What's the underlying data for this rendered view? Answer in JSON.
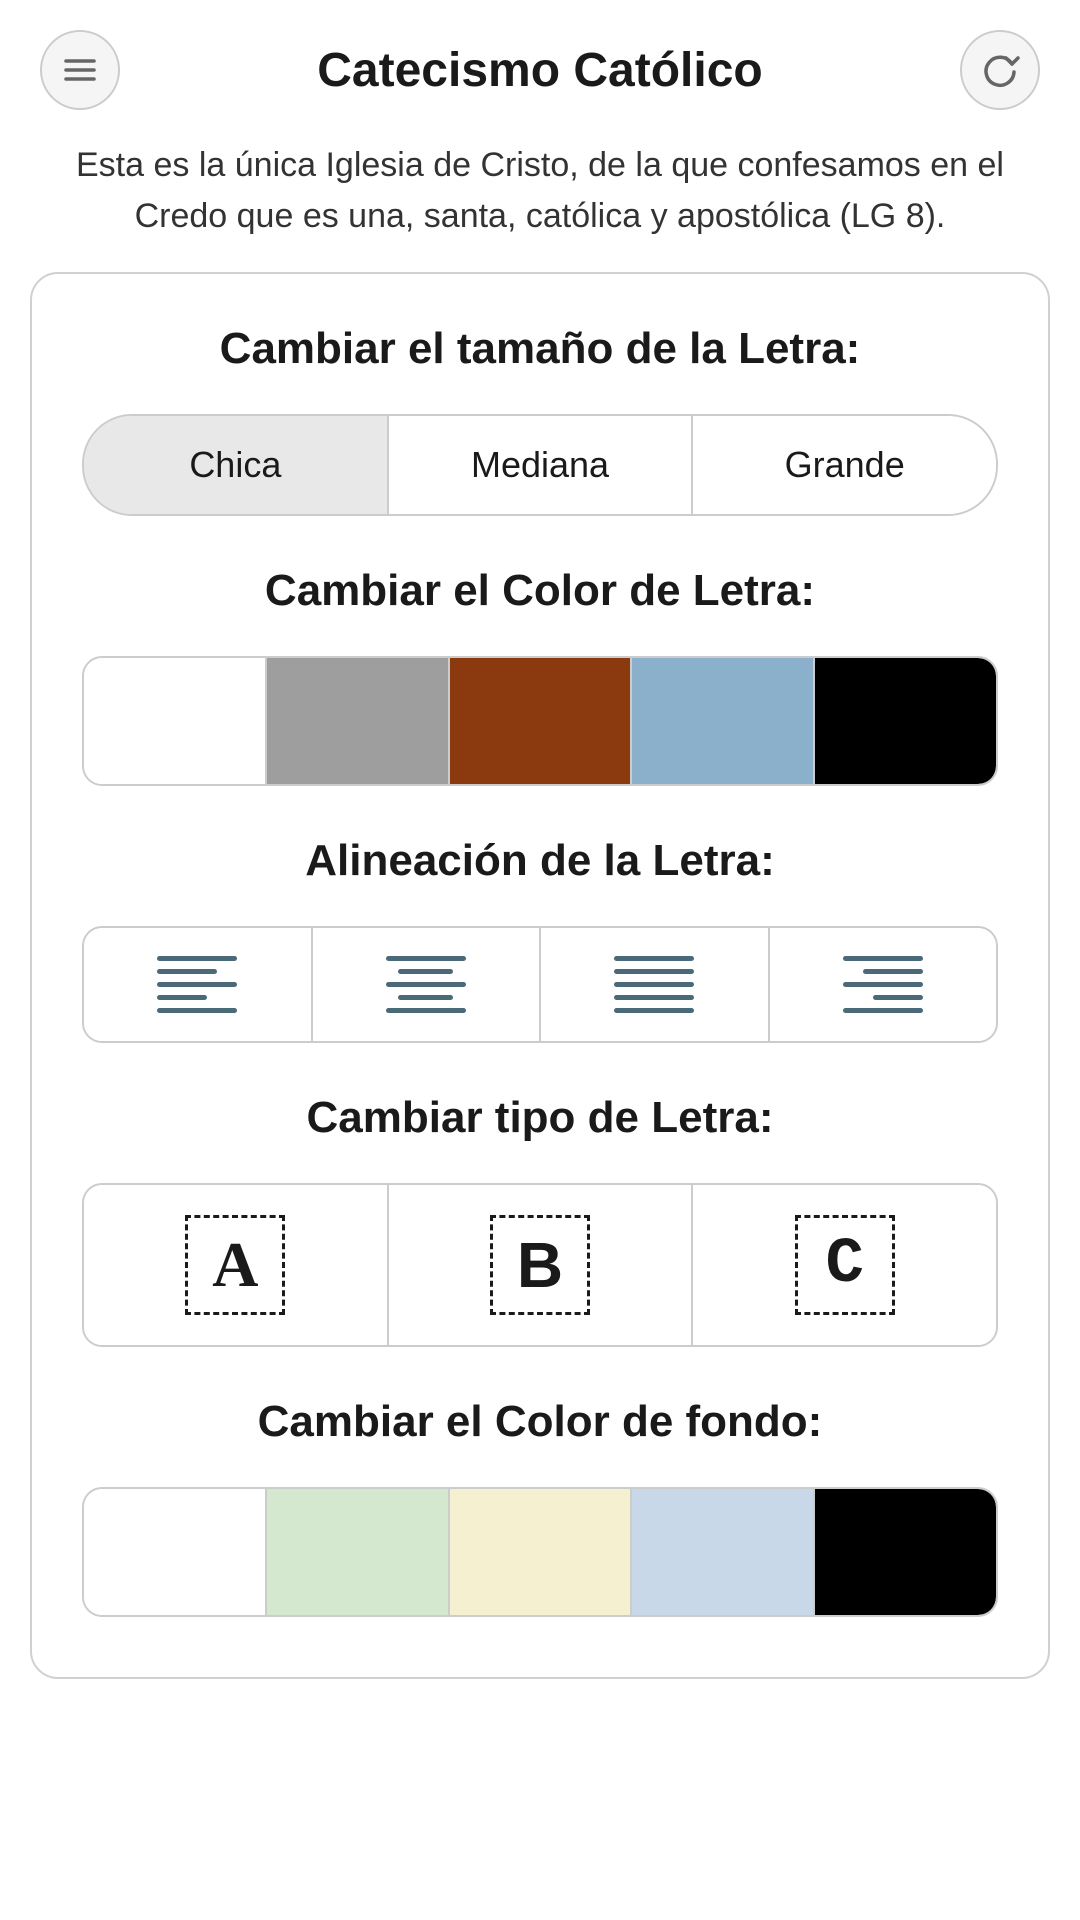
{
  "header": {
    "title": "Catecismo Católico",
    "menu_icon": "menu-icon",
    "refresh_icon": "refresh-icon"
  },
  "subtitle": {
    "text": "Esta es la única Iglesia de Cristo, de la que confesamos en el Credo que es una, santa, católica y apostólica (LG 8)."
  },
  "font_size_section": {
    "title": "Cambiar el tamaño de la Letra:",
    "options": [
      {
        "label": "Chica",
        "active": true
      },
      {
        "label": "Mediana",
        "active": false
      },
      {
        "label": "Grande",
        "active": false
      }
    ]
  },
  "font_color_section": {
    "title": "Cambiar el Color de Letra:",
    "colors": [
      {
        "hex": "#ffffff",
        "name": "white"
      },
      {
        "hex": "#9e9e9e",
        "name": "gray"
      },
      {
        "hex": "#8b3a0f",
        "name": "brown"
      },
      {
        "hex": "#8ab0cc",
        "name": "light-blue"
      },
      {
        "hex": "#000000",
        "name": "black"
      }
    ]
  },
  "alignment_section": {
    "title": "Alineación de la Letra:",
    "options": [
      {
        "name": "align-left",
        "label": "left"
      },
      {
        "name": "align-center",
        "label": "center"
      },
      {
        "name": "align-justify",
        "label": "justify"
      },
      {
        "name": "align-right",
        "label": "right"
      }
    ]
  },
  "font_type_section": {
    "title": "Cambiar tipo de Letra:",
    "options": [
      {
        "label": "A",
        "style": "serif"
      },
      {
        "label": "B",
        "style": "sans"
      },
      {
        "label": "C",
        "style": "mono"
      }
    ]
  },
  "bg_color_section": {
    "title": "Cambiar el Color de fondo:",
    "colors": [
      {
        "hex": "#ffffff",
        "name": "white"
      },
      {
        "hex": "#d4e8d0",
        "name": "light-green"
      },
      {
        "hex": "#f5f0d0",
        "name": "light-yellow"
      },
      {
        "hex": "#c8d8e8",
        "name": "light-blue"
      },
      {
        "hex": "#000000",
        "name": "black"
      }
    ]
  }
}
